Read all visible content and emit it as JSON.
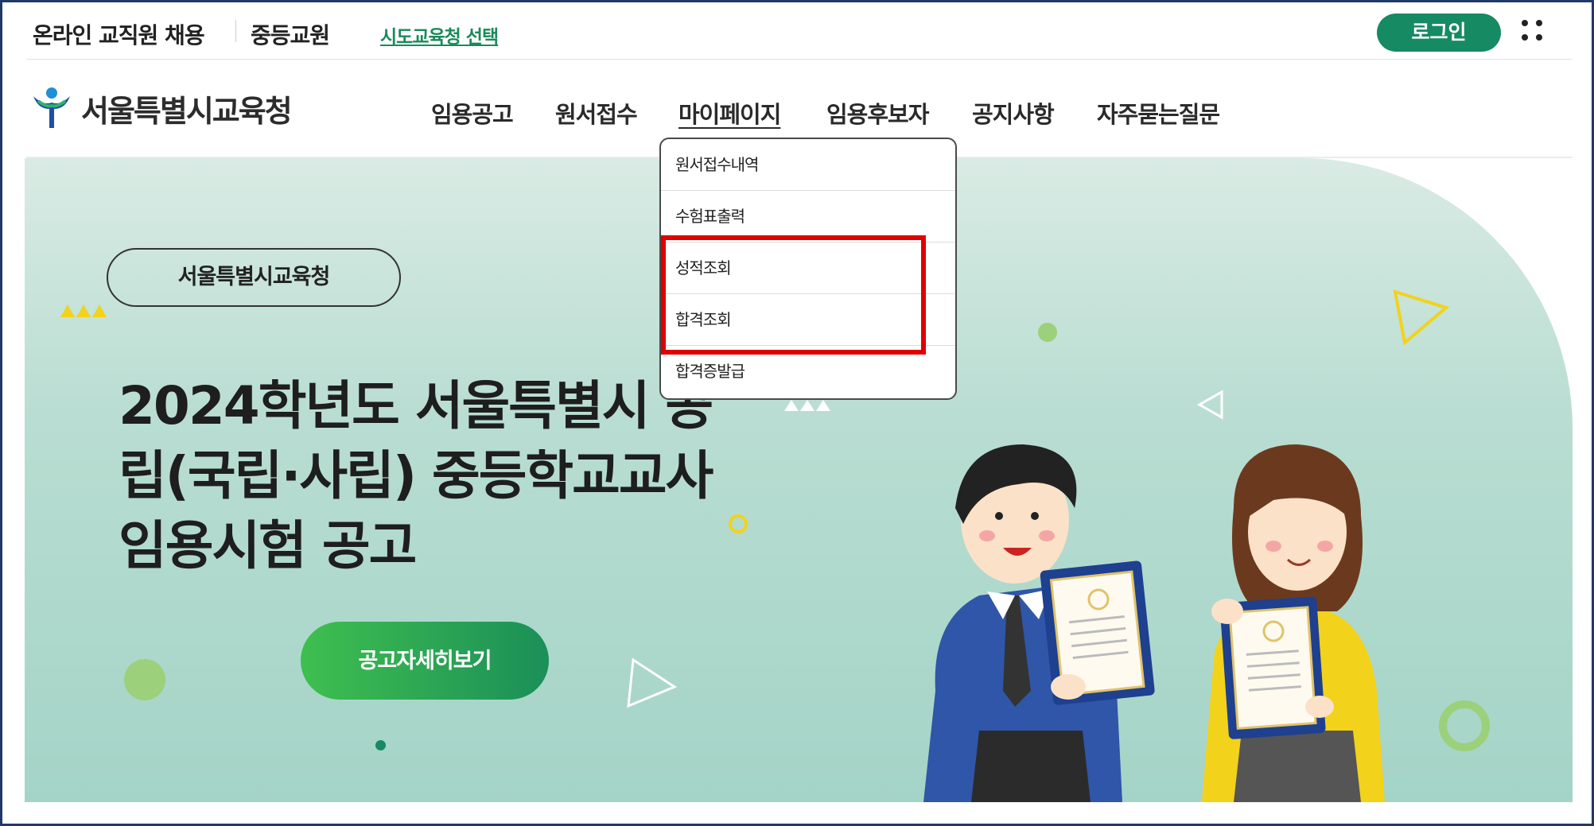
{
  "header": {
    "site_title": "온라인 교직원 채용",
    "sub_title": "중등교원",
    "region_link": "시도교육청 선택",
    "login_label": "로그인"
  },
  "nav": {
    "logo_text": "서울특별시교육청",
    "items": [
      {
        "label": "임용공고"
      },
      {
        "label": "원서접수"
      },
      {
        "label": "마이페이지"
      },
      {
        "label": "임용후보자"
      },
      {
        "label": "공지사항"
      },
      {
        "label": "자주묻는질문"
      }
    ],
    "active_index": 2
  },
  "dropdown": {
    "items": [
      {
        "label": "원서접수내역"
      },
      {
        "label": "수험표출력"
      },
      {
        "label": "성적조회"
      },
      {
        "label": "합격조회"
      },
      {
        "label": "합격증발급"
      }
    ],
    "highlighted": [
      "성적조회",
      "합격조회"
    ]
  },
  "hero": {
    "badge": "서울특별시교육청",
    "title_line1": "2024학년도 서울특별시 공",
    "title_line2": "립(국립·사립) 중등학교교사",
    "title_line3": "임용시험 공고",
    "button_label": "공고자세히보기"
  },
  "colors": {
    "brand_green": "#168a63",
    "hero_bg": "#b9ddd2",
    "highlight_red": "#e00000",
    "accent_yellow": "#f2d21b"
  },
  "icons": {
    "logo": "seoul-education-logo-icon",
    "menu": "grid-dots-icon"
  }
}
